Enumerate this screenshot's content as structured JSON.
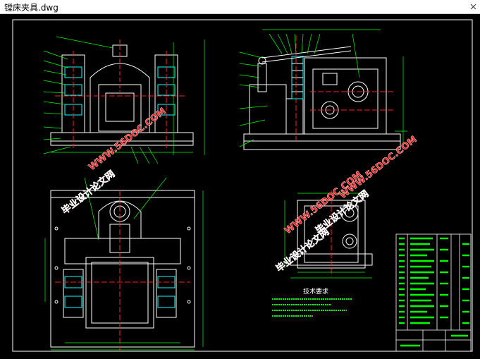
{
  "window": {
    "title": "镗床夹具.dwg"
  },
  "drawing": {
    "tech_req_title": "技术要求",
    "colors": {
      "frame": "#ffffff",
      "outline": "#ffffff",
      "green": "#00ff00",
      "red": "#ff2020",
      "cyan": "#00ffff",
      "watermark": "#ff2020"
    }
  },
  "watermark": {
    "url1": "WWW.56DOC.COM",
    "url2": "WWW.56DOC.COM",
    "url3": "WWW.56DOC.COM",
    "text1": "毕业设计论文网",
    "text2": "毕业设计论文网",
    "text3": "毕业设计论文网"
  }
}
